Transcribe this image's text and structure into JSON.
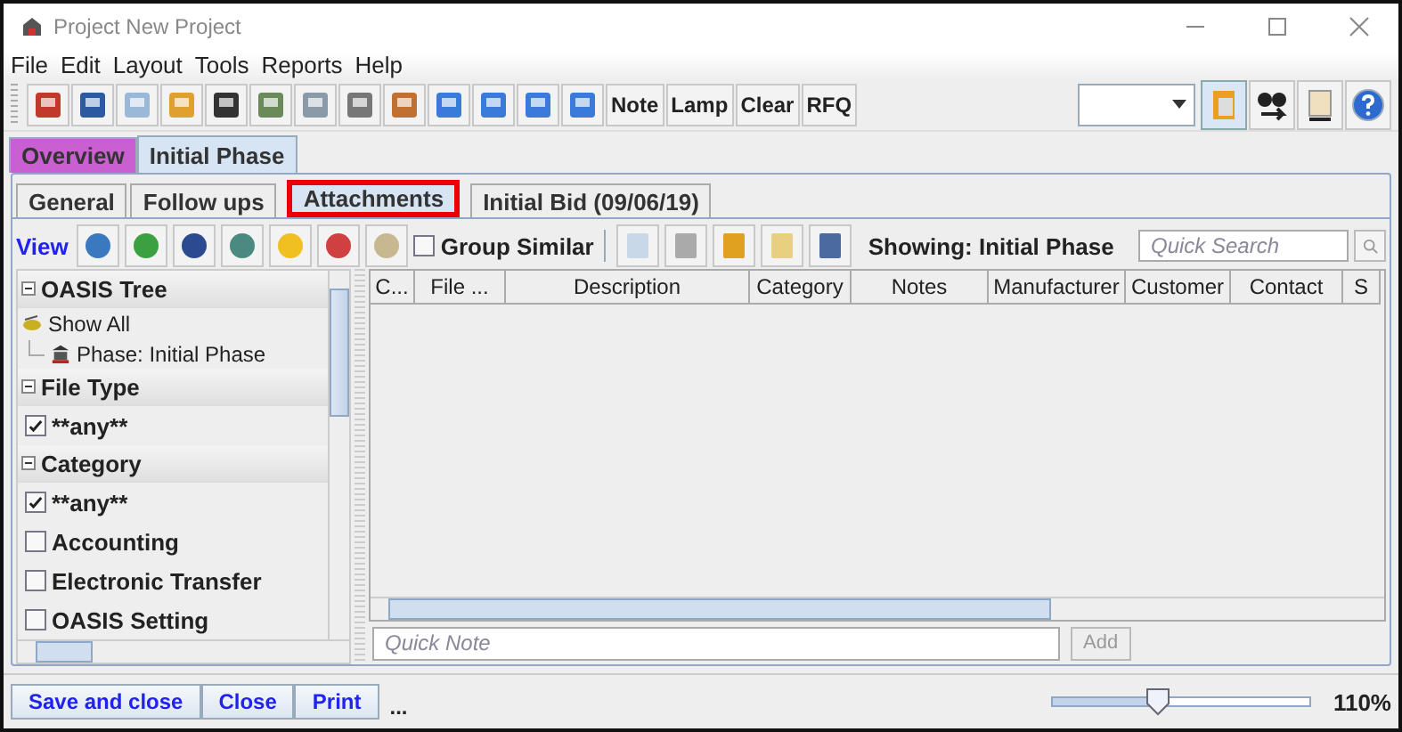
{
  "window": {
    "title": "Project New Project"
  },
  "menu": [
    "File",
    "Edit",
    "Layout",
    "Tools",
    "Reports",
    "Help"
  ],
  "toolbar": {
    "text_buttons": [
      "Note",
      "Lamp",
      "Clear",
      "RFQ"
    ]
  },
  "main_tabs": [
    {
      "label": "Overview",
      "selected": false,
      "color": "#c95fd0"
    },
    {
      "label": "Initial Phase",
      "selected": true,
      "color": "#d6e4f3"
    }
  ],
  "sub_tabs": [
    {
      "label": "General",
      "selected": false,
      "highlighted": false
    },
    {
      "label": "Follow ups",
      "selected": false,
      "highlighted": false
    },
    {
      "label": "Attachments",
      "selected": true,
      "highlighted": true
    },
    {
      "label": "Initial Bid (09/06/19)",
      "selected": false,
      "highlighted": false
    }
  ],
  "view_bar": {
    "label": "View",
    "group_similar": {
      "label": "Group Similar",
      "checked": false
    },
    "showing": "Showing: Initial Phase",
    "search": {
      "placeholder": "Quick Search"
    }
  },
  "sidebar": {
    "sections": [
      {
        "title": "OASIS Tree",
        "expanded": true,
        "items": [
          {
            "kind": "tree",
            "label": "Show All",
            "children": [
              {
                "kind": "tree",
                "label": "Phase: Initial Phase"
              }
            ]
          }
        ]
      },
      {
        "title": "File Type",
        "expanded": true,
        "items": [
          {
            "kind": "checkbox",
            "label": "**any**",
            "checked": true
          }
        ]
      },
      {
        "title": "Category",
        "expanded": true,
        "items": [
          {
            "kind": "checkbox",
            "label": "**any**",
            "checked": true
          },
          {
            "kind": "checkbox",
            "label": "Accounting",
            "checked": false
          },
          {
            "kind": "checkbox",
            "label": "Electronic Transfer",
            "checked": false
          },
          {
            "kind": "checkbox",
            "label": "OASIS Setting",
            "checked": false
          }
        ]
      }
    ]
  },
  "table": {
    "columns": [
      "C...",
      "File ...",
      "Description",
      "Category",
      "Notes",
      "Manufacturer",
      "Customer",
      "Contact",
      "S"
    ]
  },
  "quick_note": {
    "placeholder": "Quick Note",
    "add_button": {
      "label": "Add",
      "disabled": true
    }
  },
  "footer": {
    "buttons": [
      "Save and close",
      "Close",
      "Print"
    ],
    "status": "...",
    "zoom": {
      "level": 0.41,
      "reading": "110%"
    }
  }
}
